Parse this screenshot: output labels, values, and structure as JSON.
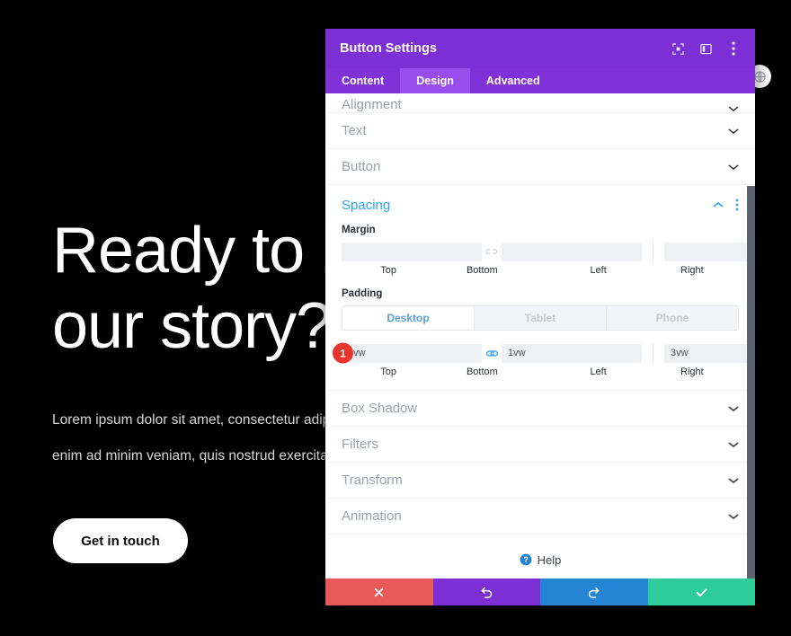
{
  "background": {
    "heading_line1": "Ready to b",
    "heading_line2": "our story?",
    "paragraph_line1": "Lorem ipsum dolor sit amet, consectetur adipiscin",
    "paragraph_line2": "enim ad minim veniam, quis nostrud exercitation",
    "cta_label": "Get in touch",
    "bg_color": "#000000",
    "text_color": "#ffffff"
  },
  "floating": {
    "globe_icon": "globe-icon"
  },
  "modal": {
    "title": "Button Settings",
    "accent_color": "#7b2fd4",
    "header_icons": [
      {
        "name": "focus-icon",
        "label": "Focus"
      },
      {
        "name": "layout-split-icon",
        "label": "Layout"
      },
      {
        "name": "more-vertical-icon",
        "label": "More options"
      }
    ],
    "tabs": [
      {
        "label": "Content",
        "active": false
      },
      {
        "label": "Design",
        "active": true
      },
      {
        "label": "Advanced",
        "active": false
      }
    ],
    "sections_above": [
      {
        "label": "Alignment",
        "open": false,
        "clipped": true
      },
      {
        "label": "Text",
        "open": false,
        "clipped": false
      },
      {
        "label": "Button",
        "open": false,
        "clipped": false
      }
    ],
    "spacing": {
      "title": "Spacing",
      "title_color": "#2ea3f2",
      "expanded": true,
      "margin": {
        "label": "Margin",
        "link_active": false,
        "fields": [
          {
            "label": "Top",
            "value": "",
            "placeholder": ""
          },
          {
            "label": "Bottom",
            "value": "",
            "placeholder": ""
          },
          {
            "label": "Left",
            "value": "",
            "placeholder": ""
          },
          {
            "label": "Right",
            "value": "",
            "placeholder": ""
          }
        ]
      },
      "padding": {
        "label": "Padding",
        "link_active": true,
        "devices": [
          {
            "label": "Desktop",
            "active": true
          },
          {
            "label": "Tablet",
            "active": false
          },
          {
            "label": "Phone",
            "active": false
          }
        ],
        "fields": [
          {
            "label": "Top",
            "value": "1vw"
          },
          {
            "label": "Bottom",
            "value": "1vw"
          },
          {
            "label": "Left",
            "value": "3vw"
          },
          {
            "label": "Right",
            "value": "3vw"
          }
        ],
        "annotation_badge": "1",
        "badge_color": "#e8352e"
      }
    },
    "sections_below": [
      {
        "label": "Box Shadow",
        "open": false
      },
      {
        "label": "Filters",
        "open": false
      },
      {
        "label": "Transform",
        "open": false
      },
      {
        "label": "Animation",
        "open": false
      }
    ],
    "help": {
      "label": "Help",
      "icon": "help-circle-icon"
    },
    "footer_buttons": [
      {
        "name": "cancel",
        "icon": "close-icon",
        "color": "#e8595a"
      },
      {
        "name": "undo",
        "icon": "undo-icon",
        "color": "#7b2fd4"
      },
      {
        "name": "redo",
        "icon": "redo-icon",
        "color": "#2585d4"
      },
      {
        "name": "save",
        "icon": "check-icon",
        "color": "#2ecc9a"
      }
    ]
  }
}
